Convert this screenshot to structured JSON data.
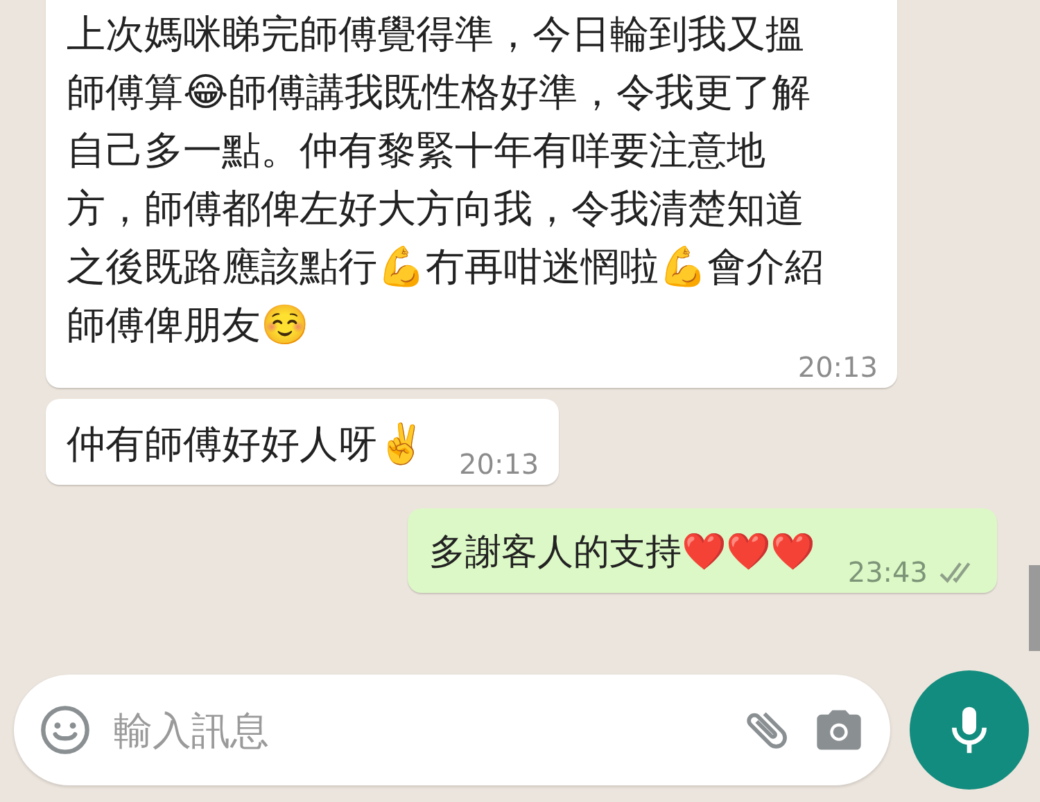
{
  "messages": [
    {
      "kind": "incoming",
      "text": "上次媽咪睇完師傅覺得準，今日輪到我又搵師傅算😂師傅講我既性格好準，令我更了解自己多一點。仲有黎緊十年有咩要注意地方，師傅都俾左好大方向我，令我清楚知道之後既路應該點行💪冇再咁迷惘啦💪會介紹師傅俾朋友☺️",
      "time": "20:13"
    },
    {
      "kind": "incoming",
      "text": "仲有師傅好好人呀✌️",
      "time": "20:13"
    },
    {
      "kind": "outgoing",
      "text": "多謝客人的支持❤️❤️❤️",
      "time": "23:43",
      "read": false
    }
  ],
  "composer": {
    "placeholder": "輸入訊息"
  }
}
